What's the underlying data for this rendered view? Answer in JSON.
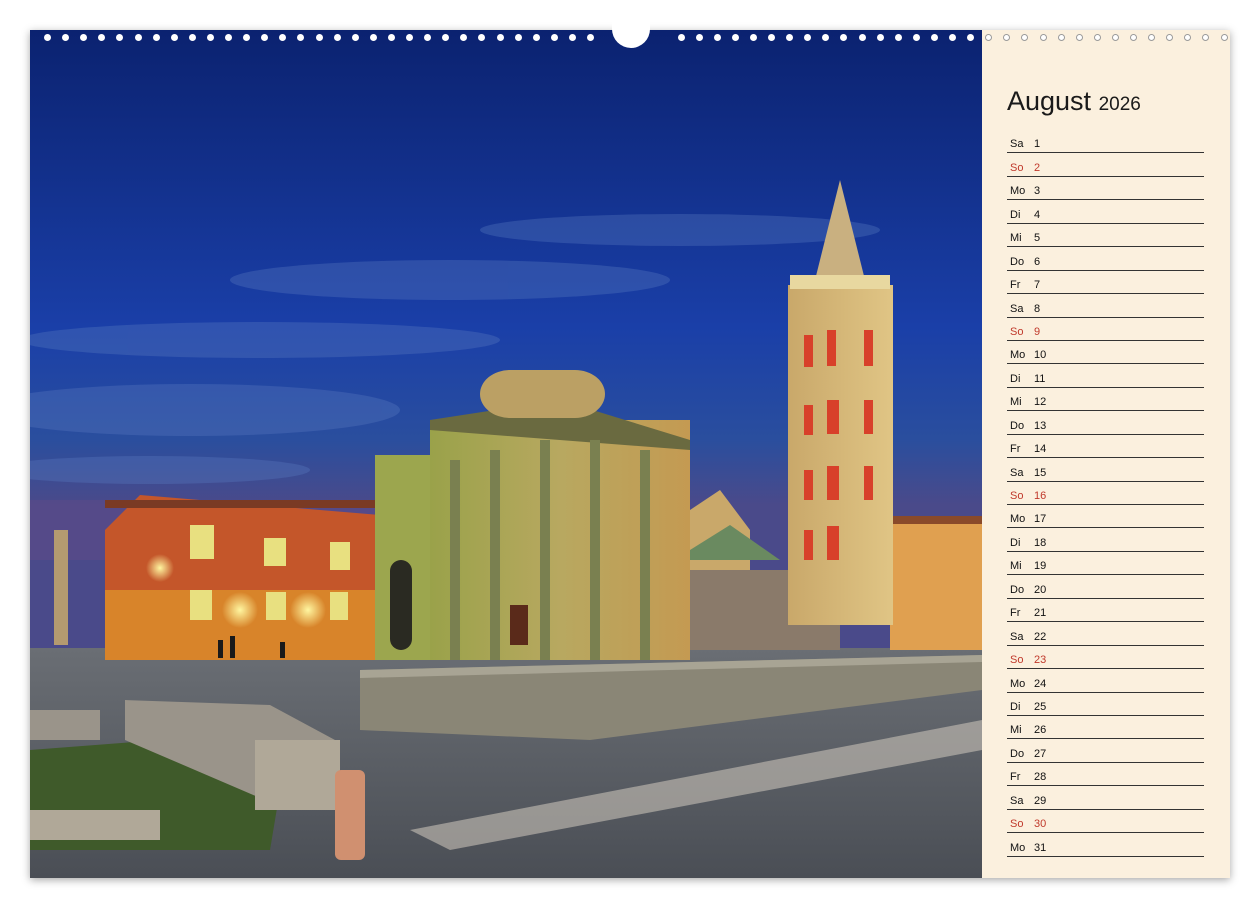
{
  "calendar": {
    "month": "August",
    "year": "2026",
    "days": [
      {
        "dn": "Sa",
        "d": "1",
        "sun": false
      },
      {
        "dn": "So",
        "d": "2",
        "sun": true
      },
      {
        "dn": "Mo",
        "d": "3",
        "sun": false
      },
      {
        "dn": "Di",
        "d": "4",
        "sun": false
      },
      {
        "dn": "Mi",
        "d": "5",
        "sun": false
      },
      {
        "dn": "Do",
        "d": "6",
        "sun": false
      },
      {
        "dn": "Fr",
        "d": "7",
        "sun": false
      },
      {
        "dn": "Sa",
        "d": "8",
        "sun": false
      },
      {
        "dn": "So",
        "d": "9",
        "sun": true
      },
      {
        "dn": "Mo",
        "d": "10",
        "sun": false
      },
      {
        "dn": "Di",
        "d": "11",
        "sun": false
      },
      {
        "dn": "Mi",
        "d": "12",
        "sun": false
      },
      {
        "dn": "Do",
        "d": "13",
        "sun": false
      },
      {
        "dn": "Fr",
        "d": "14",
        "sun": false
      },
      {
        "dn": "Sa",
        "d": "15",
        "sun": false
      },
      {
        "dn": "So",
        "d": "16",
        "sun": true
      },
      {
        "dn": "Mo",
        "d": "17",
        "sun": false
      },
      {
        "dn": "Di",
        "d": "18",
        "sun": false
      },
      {
        "dn": "Mi",
        "d": "19",
        "sun": false
      },
      {
        "dn": "Do",
        "d": "20",
        "sun": false
      },
      {
        "dn": "Fr",
        "d": "21",
        "sun": false
      },
      {
        "dn": "Sa",
        "d": "22",
        "sun": false
      },
      {
        "dn": "So",
        "d": "23",
        "sun": true
      },
      {
        "dn": "Mo",
        "d": "24",
        "sun": false
      },
      {
        "dn": "Di",
        "d": "25",
        "sun": false
      },
      {
        "dn": "Mi",
        "d": "26",
        "sun": false
      },
      {
        "dn": "Do",
        "d": "27",
        "sun": false
      },
      {
        "dn": "Fr",
        "d": "28",
        "sun": false
      },
      {
        "dn": "Sa",
        "d": "29",
        "sun": false
      },
      {
        "dn": "So",
        "d": "30",
        "sun": true
      },
      {
        "dn": "Mo",
        "d": "31",
        "sun": false
      }
    ]
  },
  "colors": {
    "sunday": "#c0392b",
    "panel_bg": "#fbf0de",
    "sky": "#0f2a7a"
  }
}
